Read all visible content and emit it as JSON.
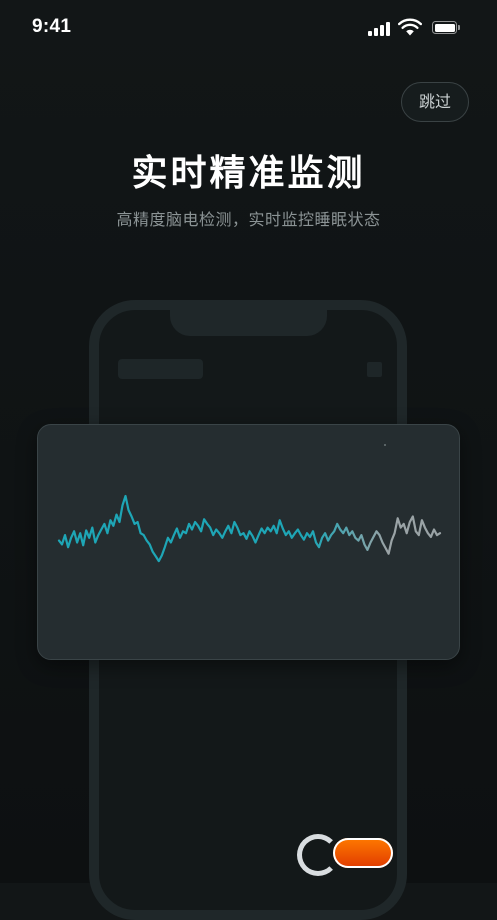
{
  "status_bar": {
    "time": "9:41"
  },
  "header": {
    "skip_label": "跳过"
  },
  "main": {
    "title": "实时精准监测",
    "subtitle": "高精度脑电检测，实时监控睡眠状态"
  },
  "eeg_wave": {
    "colors": {
      "primary": "#1ea6b6",
      "fade": "#9aa3a6",
      "card": "#252d30"
    },
    "samples": [
      0.52,
      0.48,
      0.58,
      0.45,
      0.55,
      0.62,
      0.5,
      0.6,
      0.47,
      0.63,
      0.55,
      0.66,
      0.5,
      0.58,
      0.64,
      0.7,
      0.6,
      0.74,
      0.68,
      0.8,
      0.72,
      0.9,
      1.0,
      0.85,
      0.78,
      0.7,
      0.72,
      0.6,
      0.58,
      0.52,
      0.48,
      0.4,
      0.35,
      0.3,
      0.36,
      0.45,
      0.55,
      0.5,
      0.58,
      0.65,
      0.55,
      0.62,
      0.6,
      0.7,
      0.64,
      0.72,
      0.68,
      0.62,
      0.75,
      0.7,
      0.66,
      0.58,
      0.64,
      0.6,
      0.55,
      0.62,
      0.68,
      0.6,
      0.72,
      0.66,
      0.58,
      0.6,
      0.54,
      0.62,
      0.57,
      0.5,
      0.58,
      0.65,
      0.6,
      0.66,
      0.62,
      0.68,
      0.6,
      0.74,
      0.65,
      0.58,
      0.62,
      0.55,
      0.6,
      0.64,
      0.58,
      0.53,
      0.6,
      0.56,
      0.62,
      0.5,
      0.45,
      0.55,
      0.6,
      0.52,
      0.58,
      0.62,
      0.7,
      0.64,
      0.6,
      0.66,
      0.58,
      0.62,
      0.55,
      0.52,
      0.58,
      0.48,
      0.42,
      0.5,
      0.56,
      0.62,
      0.58,
      0.5,
      0.44,
      0.38,
      0.52,
      0.6,
      0.76,
      0.66,
      0.7,
      0.6,
      0.72,
      0.78,
      0.62,
      0.58,
      0.74,
      0.66,
      0.6,
      0.56,
      0.64,
      0.58,
      0.6
    ]
  }
}
